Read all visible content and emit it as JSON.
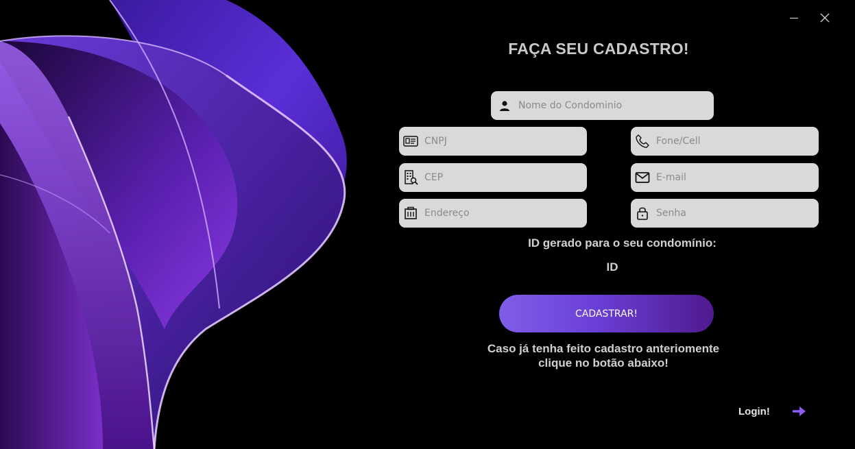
{
  "window": {
    "controls": {
      "minimize_icon": "minimize-icon",
      "close_icon": "close-icon"
    }
  },
  "form": {
    "title": "FAÇA SEU CADASTRO!",
    "fields": {
      "nome": {
        "placeholder": "Nome do Condominio",
        "value": "",
        "icon": "user-icon"
      },
      "cnpj": {
        "placeholder": "CNPJ",
        "value": "",
        "icon": "id-card-icon"
      },
      "fone": {
        "placeholder": "Fone/Cell",
        "value": "",
        "icon": "phone-icon"
      },
      "cep": {
        "placeholder": "CEP",
        "value": "",
        "icon": "building-search-icon"
      },
      "email": {
        "placeholder": "E-mail",
        "value": "",
        "icon": "envelope-icon"
      },
      "endereco": {
        "placeholder": "Endereço",
        "value": "",
        "icon": "building-icon"
      },
      "senha": {
        "placeholder": "Senha",
        "value": "",
        "icon": "lock-icon"
      }
    },
    "id_label": "ID gerado para o seu condomínio:",
    "id_value": "ID",
    "submit_label": "CADASTRAR!",
    "hint_line1": "Caso já tenha feito cadastro anteriomente",
    "hint_line2": "clique no botão abaixo!",
    "login_label": "Login!"
  },
  "colors": {
    "background": "#000000",
    "field_bg": "#d9d9d9",
    "accent_start": "#7f5ee8",
    "accent_end": "#4f1a8e",
    "arrow": "#8b5cf6",
    "text_muted": "#c9c9c9"
  }
}
